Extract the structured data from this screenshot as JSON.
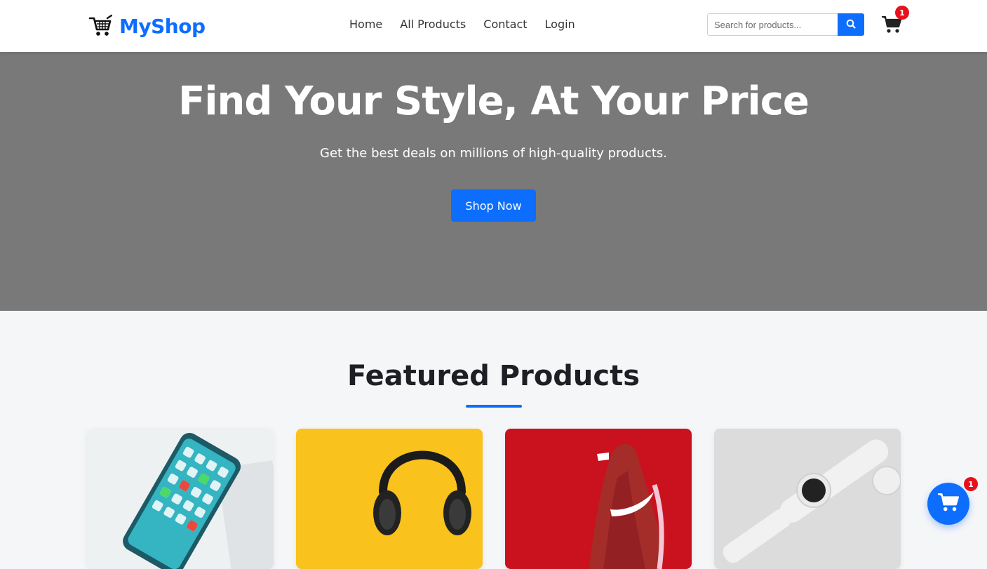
{
  "brand": {
    "name": "MyShop",
    "icon": "shopping-cart-icon",
    "color": "#0d6efd"
  },
  "nav": {
    "links": [
      {
        "label": "Home"
      },
      {
        "label": "All Products"
      },
      {
        "label": "Contact"
      },
      {
        "label": "Login"
      }
    ]
  },
  "search": {
    "placeholder": "Search for products...",
    "value": "",
    "icon": "search-icon"
  },
  "cart": {
    "icon": "cart-icon",
    "count": "1"
  },
  "hero": {
    "title": "Find Your Style, At Your Price",
    "subtitle": "Get the best deals on millions of high-quality products.",
    "cta_label": "Shop Now",
    "background": "#797979"
  },
  "featured": {
    "title": "Featured Products",
    "products": [
      {
        "image": "smartphone-photo"
      },
      {
        "image": "headphones-photo"
      },
      {
        "image": "sneaker-photo"
      },
      {
        "image": "smartwatch-photo"
      }
    ]
  },
  "floating_cart": {
    "icon": "cart-icon",
    "count": "1"
  },
  "colors": {
    "accent": "#0d6efd",
    "badge": "#e8101b",
    "page_bg": "#f5f6f8"
  }
}
